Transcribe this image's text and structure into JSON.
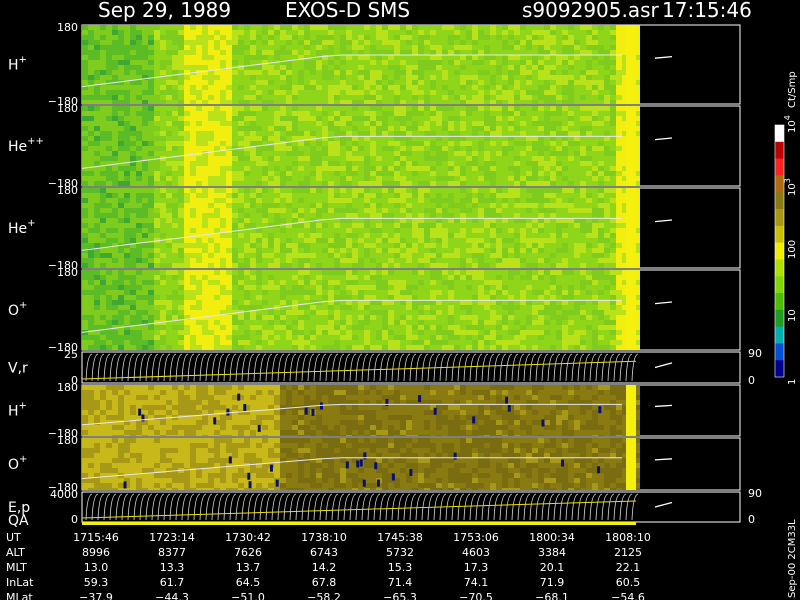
{
  "header": {
    "date": "Sep 29, 1989",
    "instrument": "EXOS-D SMS",
    "file": "s9092905.asr",
    "time": "17:15:46"
  },
  "chart_data": {
    "type": "heatmap",
    "title": "Sep 29, 1989   EXOS-D SMS",
    "panels": [
      {
        "name": "H+",
        "label_base": "H",
        "label_sup": "+",
        "ymax_label": "180",
        "ymin_label": "−180",
        "colormap": "green"
      },
      {
        "name": "He++",
        "label_base": "He",
        "label_sup": "++",
        "ymax_label": "180",
        "ymin_label": "−180",
        "colormap": "green"
      },
      {
        "name": "He+",
        "label_base": "He",
        "label_sup": "+",
        "ymax_label": "180",
        "ymin_label": "−180",
        "colormap": "green"
      },
      {
        "name": "O+",
        "label_base": "O",
        "label_sup": "+",
        "ymax_label": "180",
        "ymin_label": "−180",
        "colormap": "green"
      },
      {
        "name": "V,r",
        "label_base": "V,r",
        "label_sup": "",
        "ymax_label": "25",
        "ymin_label": "0",
        "right_top": "90",
        "right_bottom": "0",
        "colormap": "lines"
      },
      {
        "name": "H+",
        "label_base": "H",
        "label_sup": "+",
        "ymax_label": "180",
        "ymin_label": "−180",
        "colormap": "olive"
      },
      {
        "name": "O+",
        "label_base": "O",
        "label_sup": "+",
        "ymax_label": "180",
        "ymin_label": "−180",
        "colormap": "olive"
      },
      {
        "name": "E,p",
        "label_base": "E,p",
        "label_sup": "",
        "ymax_label": "4000",
        "ymin_label": "0",
        "right_top": "90",
        "right_bottom": "0",
        "colormap": "lines",
        "extra_label": "QA"
      }
    ],
    "colorbar": {
      "unit": "Ct/Smp",
      "ticks": [
        {
          "label": "10",
          "sup": "4",
          "frac": 1.0
        },
        {
          "label": "10",
          "sup": "3",
          "frac": 0.75
        },
        {
          "label": "100",
          "sup": "",
          "frac": 0.5
        },
        {
          "label": "10",
          "sup": "",
          "frac": 0.25
        },
        {
          "label": "1",
          "sup": "",
          "frac": 0.0
        }
      ],
      "colors": [
        "#ffffff",
        "#c00000",
        "#ff2020",
        "#b06a10",
        "#8a7a10",
        "#a89a10",
        "#c8c000",
        "#f0ee00",
        "#aee000",
        "#7fd800",
        "#4cbf00",
        "#1e9e1e",
        "#00b0b0",
        "#0050d8",
        "#000090"
      ]
    },
    "orbit_table": {
      "rows": [
        {
          "label": "UT",
          "values": [
            "1715:46",
            "1723:14",
            "1730:42",
            "1738:10",
            "1745:38",
            "1753:06",
            "1800:34",
            "1808:10"
          ]
        },
        {
          "label": "ALT",
          "values": [
            "8996",
            "8377",
            "7626",
            "6743",
            "5732",
            "4603",
            "3384",
            "2125"
          ]
        },
        {
          "label": "MLT",
          "values": [
            "13.0",
            "13.3",
            "13.7",
            "14.2",
            "15.3",
            "17.3",
            "20.1",
            "22.1"
          ]
        },
        {
          "label": "InLat",
          "values": [
            "59.3",
            "61.7",
            "64.5",
            "67.8",
            "71.4",
            "74.1",
            "71.9",
            "60.5"
          ]
        },
        {
          "label": "MLat",
          "values": [
            "−37.9",
            "−44.3",
            "−51.0",
            "−58.2",
            "−65.3",
            "−70.5",
            "−68.1",
            "−54.6"
          ]
        }
      ]
    },
    "side_note": "Sep-00 2CM33L"
  }
}
